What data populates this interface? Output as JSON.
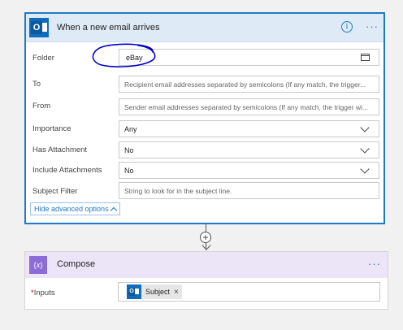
{
  "trigger": {
    "title": "When a new email arrives",
    "info_glyph": "i",
    "more_glyph": "···",
    "brand_color": "#0f6cbd",
    "accent_color": "#1e79c8",
    "fields": {
      "folder": {
        "label": "Folder",
        "value": "eBay"
      },
      "to": {
        "label": "To",
        "placeholder": "Recipient email addresses separated by semicolons (If any match, the trigger..."
      },
      "from": {
        "label": "From",
        "placeholder": "Sender email addresses separated by semicolons (If any match, the trigger wi..."
      },
      "importance": {
        "label": "Importance",
        "value": "Any"
      },
      "has_attachment": {
        "label": "Has Attachment",
        "value": "No"
      },
      "include_attachments": {
        "label": "Include Attachments",
        "value": "No"
      },
      "subject_filter": {
        "label": "Subject Filter",
        "placeholder": "String to look for in the subject line."
      }
    },
    "advanced_toggle": "Hide advanced options",
    "annotation_color": "#0000cc"
  },
  "connector": {
    "plus_glyph": "+"
  },
  "compose": {
    "title": "Compose",
    "icon_glyph": "{𝑥}",
    "more_glyph": "···",
    "icon_color": "#8c6cd5",
    "inputs_required_mark": "*",
    "inputs_label": "Inputs",
    "token": {
      "label": "Subject",
      "remove_glyph": "×"
    }
  }
}
